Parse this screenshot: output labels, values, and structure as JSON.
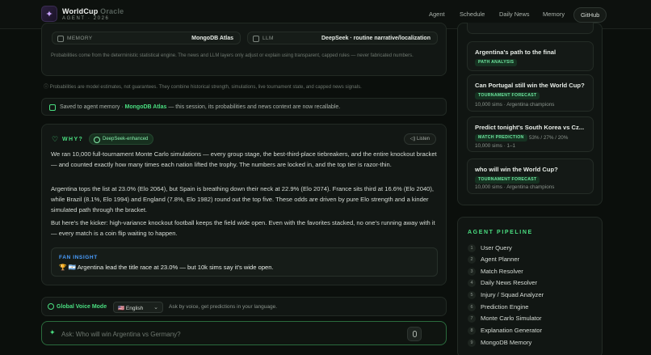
{
  "brand": {
    "title_main": "WorldCup",
    "title_fade": "Oracle",
    "subtitle": "AGENT · 2026",
    "logo_glyph": "✦"
  },
  "nav": {
    "agent": "Agent",
    "schedule": "Schedule",
    "daily_news": "Daily News",
    "memory": "Memory",
    "github": "GitHub"
  },
  "stack": {
    "memory_key": "MEMORY",
    "memory_val": "MongoDB Atlas",
    "llm_key": "LLM",
    "llm_val": "DeepSeek · routine narrative/localization",
    "note": "Probabilities come from the deterministic statistical engine. The news and LLM layers only adjust or explain using transparent, capped rules — never fabricated numbers."
  },
  "disclaimer": "ⓘ Probabilities are model estimates, not guarantees. They combine historical strength, simulations, live tournament state, and capped news signals.",
  "memory_saved": {
    "prefix": "Saved to agent memory · ",
    "highlight": "MongoDB Atlas",
    "suffix": " — this session, its probabilities and news context are now recallable."
  },
  "why": {
    "label": "WHY?",
    "badge": "DeepSeek-enhanced",
    "listen": "◁) Listen",
    "p1": "We ran 10,000 full-tournament Monte Carlo simulations — every group stage, the best-third-place tiebreakers, and the entire knockout bracket — and counted exactly how many times each nation lifted the trophy. The numbers are locked in, and the top tier is razor-thin.",
    "p2": "Argentina tops the list at 23.0% (Elo 2064), but Spain is breathing down their neck at 22.9% (Elo 2074). France sits third at 16.6% (Elo 2040), while Brazil (8.1%, Elo 1994) and England (7.8%, Elo 1982) round out the top five. These odds are driven by pure Elo strength and a kinder simulated path through the bracket.",
    "p3": "But here's the kicker: high-variance knockout football keeps the field wide open. Even with the favorites stacked, no one's running away with it — every match is a coin flip waiting to happen.",
    "insight_head": "FAN INSIGHT",
    "insight_body": "🏆 🇦🇷 Argentina lead the title race at 23.0% — but 10k sims say it's wide open."
  },
  "voice": {
    "label": "Global Voice Mode",
    "language": "🇺🇸 English",
    "hint": "Ask by voice, get predictions in your language."
  },
  "ask": {
    "placeholder": "Ask: Who will win Argentina vs Germany?"
  },
  "history": [
    {
      "title": "Argentina's path to the final",
      "tag": "PATH ANALYSIS",
      "meta": ""
    },
    {
      "title": "Can Portugal still win the World Cup?",
      "tag": "TOURNAMENT FORECAST",
      "meta": "10,000 sims · Argentina champions"
    },
    {
      "title": "Predict tonight's South Korea vs Cz...",
      "tag": "MATCH PREDICTION",
      "meta": "53% / 27% / 20%",
      "meta2": "10,000 sims · 1–1"
    },
    {
      "title": "who will win the World Cup?",
      "tag": "TOURNAMENT FORECAST",
      "meta": "10,000 sims · Argentina champions"
    }
  ],
  "pipeline": {
    "heading": "AGENT PIPELINE",
    "steps": [
      "User Query",
      "Agent Planner",
      "Match Resolver",
      "Daily News Resolver",
      "Injury / Squad Analyzer",
      "Prediction Engine",
      "Monte Carlo Simulator",
      "Explanation Generator",
      "MongoDB Memory"
    ],
    "numbers": [
      "1",
      "2",
      "3",
      "4",
      "5",
      "6",
      "7",
      "8",
      "9"
    ]
  }
}
